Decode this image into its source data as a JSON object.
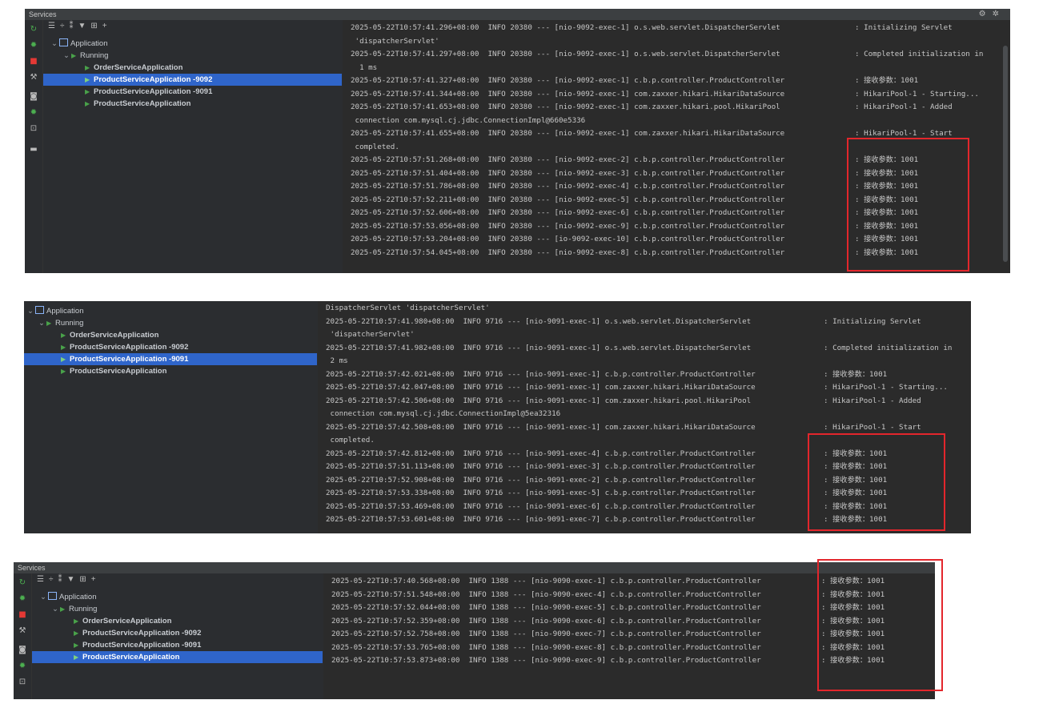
{
  "colors": {
    "highlight": "#e3262c",
    "selected_row": "#2f65ca",
    "run_icon": "#49a24a"
  },
  "panel1": {
    "title": "Services",
    "toolbar_icons": [
      "restart-icon",
      "expand-all-icon",
      "collapse-all-icon",
      "group-icon",
      "filter-icon",
      "new-tab-icon",
      "add-icon"
    ],
    "tree": {
      "root": "Application",
      "running": "Running",
      "items": [
        "OrderServiceApplication",
        "ProductServiceApplication -9092",
        "ProductServiceApplication -9091",
        "ProductServiceApplication"
      ],
      "selected": 1
    },
    "log": [
      {
        "ts": "2025-05-22T10:57:41.296+08:00",
        "level": "INFO",
        "pid": "20380",
        "thread": "[nio-9092-exec-1]",
        "logger": "o.s.web.servlet.DispatcherServlet",
        "message": ": Initializing Servlet"
      },
      {
        "cont": " 'dispatcherServlet'"
      },
      {
        "ts": "2025-05-22T10:57:41.297+08:00",
        "level": "INFO",
        "pid": "20380",
        "thread": "[nio-9092-exec-1]",
        "logger": "o.s.web.servlet.DispatcherServlet",
        "message": ": Completed initialization in"
      },
      {
        "cont": "  1 ms"
      },
      {
        "ts": "2025-05-22T10:57:41.327+08:00",
        "level": "INFO",
        "pid": "20380",
        "thread": "[nio-9092-exec-1]",
        "logger": "c.b.p.controller.ProductController",
        "message": ": 接收参数：1001"
      },
      {
        "ts": "2025-05-22T10:57:41.344+08:00",
        "level": "INFO",
        "pid": "20380",
        "thread": "[nio-9092-exec-1]",
        "logger": "com.zaxxer.hikari.HikariDataSource",
        "message": ": HikariPool-1 - Starting..."
      },
      {
        "ts": "2025-05-22T10:57:41.653+08:00",
        "level": "INFO",
        "pid": "20380",
        "thread": "[nio-9092-exec-1]",
        "logger": "com.zaxxer.hikari.pool.HikariPool",
        "message": ": HikariPool-1 - Added"
      },
      {
        "cont": " connection com.mysql.cj.jdbc.ConnectionImpl@660e5336"
      },
      {
        "ts": "2025-05-22T10:57:41.655+08:00",
        "level": "INFO",
        "pid": "20380",
        "thread": "[nio-9092-exec-1]",
        "logger": "com.zaxxer.hikari.HikariDataSource",
        "message": ": HikariPool-1 - Start"
      },
      {
        "cont": " completed."
      },
      {
        "ts": "2025-05-22T10:57:51.268+08:00",
        "level": "INFO",
        "pid": "20380",
        "thread": "[nio-9092-exec-2]",
        "logger": "c.b.p.controller.ProductController",
        "message": ": 接收参数：1001"
      },
      {
        "ts": "2025-05-22T10:57:51.404+08:00",
        "level": "INFO",
        "pid": "20380",
        "thread": "[nio-9092-exec-3]",
        "logger": "c.b.p.controller.ProductController",
        "message": ": 接收参数：1001"
      },
      {
        "ts": "2025-05-22T10:57:51.786+08:00",
        "level": "INFO",
        "pid": "20380",
        "thread": "[nio-9092-exec-4]",
        "logger": "c.b.p.controller.ProductController",
        "message": ": 接收参数：1001"
      },
      {
        "ts": "2025-05-22T10:57:52.211+08:00",
        "level": "INFO",
        "pid": "20380",
        "thread": "[nio-9092-exec-5]",
        "logger": "c.b.p.controller.ProductController",
        "message": ": 接收参数：1001"
      },
      {
        "ts": "2025-05-22T10:57:52.606+08:00",
        "level": "INFO",
        "pid": "20380",
        "thread": "[nio-9092-exec-6]",
        "logger": "c.b.p.controller.ProductController",
        "message": ": 接收参数：1001"
      },
      {
        "ts": "2025-05-22T10:57:53.056+08:00",
        "level": "INFO",
        "pid": "20380",
        "thread": "[nio-9092-exec-9]",
        "logger": "c.b.p.controller.ProductController",
        "message": ": 接收参数：1001"
      },
      {
        "ts": "2025-05-22T10:57:53.204+08:00",
        "level": "INFO",
        "pid": "20380",
        "thread": "[io-9092-exec-10]",
        "logger": "c.b.p.controller.ProductController",
        "message": ": 接收参数：1001"
      },
      {
        "ts": "2025-05-22T10:57:54.045+08:00",
        "level": "INFO",
        "pid": "20380",
        "thread": "[nio-9092-exec-8]",
        "logger": "c.b.p.controller.ProductController",
        "message": ": 接收参数：1001"
      }
    ]
  },
  "panel2": {
    "tree": {
      "root": "Application",
      "running": "Running",
      "items": [
        "OrderServiceApplication",
        "ProductServiceApplication -9092",
        "ProductServiceApplication -9091",
        "ProductServiceApplication"
      ],
      "selected": 2
    },
    "log": [
      {
        "cont": "DispatcherServlet 'dispatcherServlet'"
      },
      {
        "ts": "2025-05-22T10:57:41.980+08:00",
        "level": "INFO",
        "pid": "9716",
        "thread": "[nio-9091-exec-1]",
        "logger": "o.s.web.servlet.DispatcherServlet",
        "message": ": Initializing Servlet"
      },
      {
        "cont": " 'dispatcherServlet'"
      },
      {
        "ts": "2025-05-22T10:57:41.982+08:00",
        "level": "INFO",
        "pid": "9716",
        "thread": "[nio-9091-exec-1]",
        "logger": "o.s.web.servlet.DispatcherServlet",
        "message": ": Completed initialization in"
      },
      {
        "cont": " 2 ms"
      },
      {
        "ts": "2025-05-22T10:57:42.021+08:00",
        "level": "INFO",
        "pid": "9716",
        "thread": "[nio-9091-exec-1]",
        "logger": "c.b.p.controller.ProductController",
        "message": ": 接收参数：1001"
      },
      {
        "ts": "2025-05-22T10:57:42.047+08:00",
        "level": "INFO",
        "pid": "9716",
        "thread": "[nio-9091-exec-1]",
        "logger": "com.zaxxer.hikari.HikariDataSource",
        "message": ": HikariPool-1 - Starting..."
      },
      {
        "ts": "2025-05-22T10:57:42.506+08:00",
        "level": "INFO",
        "pid": "9716",
        "thread": "[nio-9091-exec-1]",
        "logger": "com.zaxxer.hikari.pool.HikariPool",
        "message": ": HikariPool-1 - Added"
      },
      {
        "cont": " connection com.mysql.cj.jdbc.ConnectionImpl@5ea32316"
      },
      {
        "ts": "2025-05-22T10:57:42.508+08:00",
        "level": "INFO",
        "pid": "9716",
        "thread": "[nio-9091-exec-1]",
        "logger": "com.zaxxer.hikari.HikariDataSource",
        "message": ": HikariPool-1 - Start"
      },
      {
        "cont": " completed."
      },
      {
        "ts": "2025-05-22T10:57:42.812+08:00",
        "level": "INFO",
        "pid": "9716",
        "thread": "[nio-9091-exec-4]",
        "logger": "c.b.p.controller.ProductController",
        "message": ": 接收参数：1001"
      },
      {
        "ts": "2025-05-22T10:57:51.113+08:00",
        "level": "INFO",
        "pid": "9716",
        "thread": "[nio-9091-exec-3]",
        "logger": "c.b.p.controller.ProductController",
        "message": ": 接收参数：1001"
      },
      {
        "ts": "2025-05-22T10:57:52.908+08:00",
        "level": "INFO",
        "pid": "9716",
        "thread": "[nio-9091-exec-2]",
        "logger": "c.b.p.controller.ProductController",
        "message": ": 接收参数：1001"
      },
      {
        "ts": "2025-05-22T10:57:53.338+08:00",
        "level": "INFO",
        "pid": "9716",
        "thread": "[nio-9091-exec-5]",
        "logger": "c.b.p.controller.ProductController",
        "message": ": 接收参数：1001"
      },
      {
        "ts": "2025-05-22T10:57:53.469+08:00",
        "level": "INFO",
        "pid": "9716",
        "thread": "[nio-9091-exec-6]",
        "logger": "c.b.p.controller.ProductController",
        "message": ": 接收参数：1001"
      },
      {
        "ts": "2025-05-22T10:57:53.601+08:00",
        "level": "INFO",
        "pid": "9716",
        "thread": "[nio-9091-exec-7]",
        "logger": "c.b.p.controller.ProductController",
        "message": ": 接收参数：1001"
      }
    ]
  },
  "panel3": {
    "title": "Services",
    "toolbar_icons": [
      "restart-icon",
      "expand-all-icon",
      "collapse-all-icon",
      "group-icon",
      "filter-icon",
      "new-tab-icon",
      "add-icon"
    ],
    "tree": {
      "root": "Application",
      "running": "Running",
      "items": [
        "OrderServiceApplication",
        "ProductServiceApplication -9092",
        "ProductServiceApplication -9091",
        "ProductServiceApplication"
      ],
      "selected": 3
    },
    "log": [
      {
        "ts": "2025-05-22T10:57:40.568+08:00",
        "level": "INFO",
        "pid": "1388",
        "thread": "[nio-9090-exec-1]",
        "logger": "c.b.p.controller.ProductController",
        "message": ": 接收参数：1001"
      },
      {
        "ts": "2025-05-22T10:57:51.548+08:00",
        "level": "INFO",
        "pid": "1388",
        "thread": "[nio-9090-exec-4]",
        "logger": "c.b.p.controller.ProductController",
        "message": ": 接收参数：1001"
      },
      {
        "ts": "2025-05-22T10:57:52.044+08:00",
        "level": "INFO",
        "pid": "1388",
        "thread": "[nio-9090-exec-5]",
        "logger": "c.b.p.controller.ProductController",
        "message": ": 接收参数：1001"
      },
      {
        "ts": "2025-05-22T10:57:52.359+08:00",
        "level": "INFO",
        "pid": "1388",
        "thread": "[nio-9090-exec-6]",
        "logger": "c.b.p.controller.ProductController",
        "message": ": 接收参数：1001"
      },
      {
        "ts": "2025-05-22T10:57:52.758+08:00",
        "level": "INFO",
        "pid": "1388",
        "thread": "[nio-9090-exec-7]",
        "logger": "c.b.p.controller.ProductController",
        "message": ": 接收参数：1001"
      },
      {
        "ts": "2025-05-22T10:57:53.765+08:00",
        "level": "INFO",
        "pid": "1388",
        "thread": "[nio-9090-exec-8]",
        "logger": "c.b.p.controller.ProductController",
        "message": ": 接收参数：1001"
      },
      {
        "ts": "2025-05-22T10:57:53.873+08:00",
        "level": "INFO",
        "pid": "1388",
        "thread": "[nio-9090-exec-9]",
        "logger": "c.b.p.controller.ProductController",
        "message": ": 接收参数：1001"
      }
    ]
  }
}
